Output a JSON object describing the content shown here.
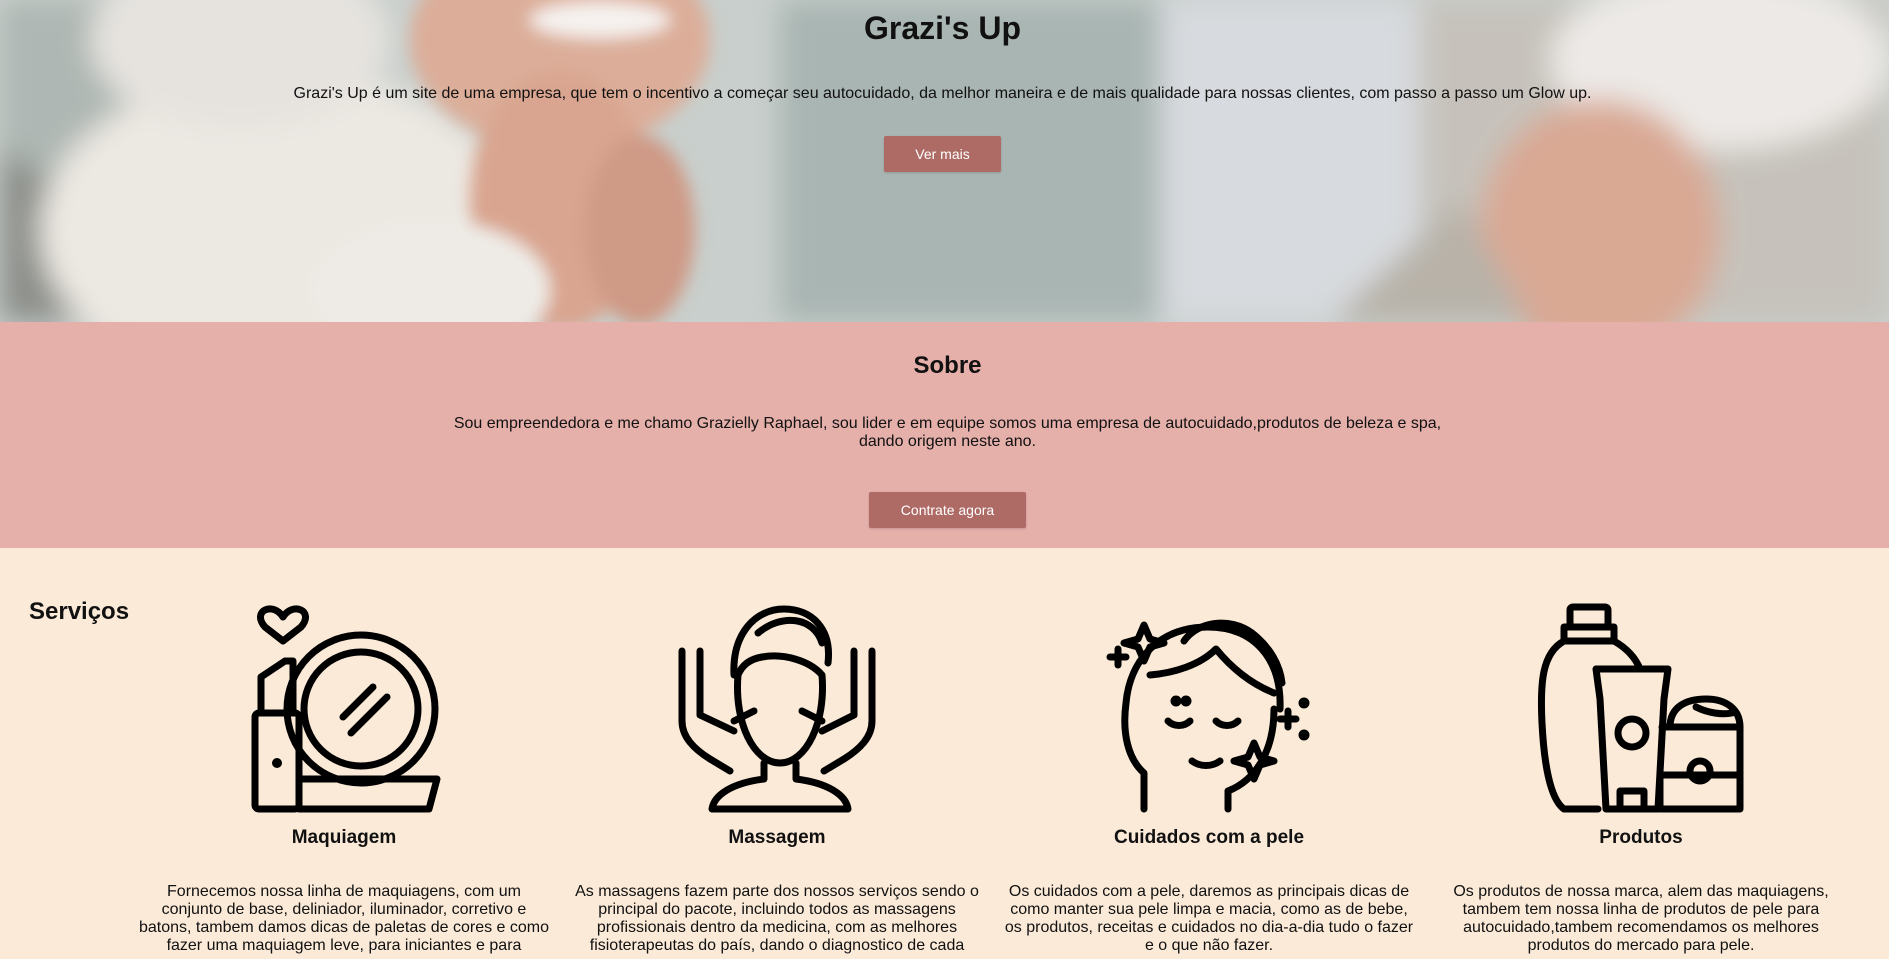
{
  "hero": {
    "title": "Grazi's Up",
    "description": "Grazi's Up é um site de uma empresa, que tem o incentivo a começar seu autocuidado, da melhor maneira e de mais qualidade para nossas clientes, com passo a passo um Glow up.",
    "button_label": "Ver mais"
  },
  "about": {
    "title": "Sobre",
    "text": "Sou empreendedora e me chamo Grazielly Raphael, sou lider e em equipe somos uma empresa de autocuidado,produtos de beleza e spa, dando origem neste ano.",
    "button_label": "Contrate agora"
  },
  "services": {
    "title": "Serviços",
    "items": [
      {
        "icon": "makeup-mirror-icon",
        "name": "Maquiagem",
        "description": "Fornecemos nossa linha de maquiagens, com um conjunto de base, deliniador, iluminador, corretivo e batons, tambem damos dicas de paletas de cores e como fazer uma maquiagem leve, para iniciantes e para"
      },
      {
        "icon": "face-massage-icon",
        "name": "Massagem",
        "description": "As massagens fazem parte dos nossos serviços sendo o principal do pacote, incluindo todos as massagens profissionais dentro da medicina, com as melhores fisioterapeutas do país, dando o diagnostico de cada"
      },
      {
        "icon": "skincare-face-icon",
        "name": "Cuidados com a pele",
        "description": "Os cuidados com a pele, daremos as principais dicas de como manter sua pele limpa e macia, como as de bebe, os produtos, receitas e cuidados no dia-a-dia tudo o fazer e o que não fazer."
      },
      {
        "icon": "beauty-products-icon",
        "name": "Produtos",
        "description": "Os produtos de nossa marca, alem das maquiagens, tambem tem nossa linha de produtos de pele para autocuidado,tambem recomendamos os melhores produtos do mercado para pele."
      }
    ]
  },
  "colors": {
    "button": "#ae6b66",
    "about_background": "#e5afaa",
    "services_background": "#fbead8"
  }
}
